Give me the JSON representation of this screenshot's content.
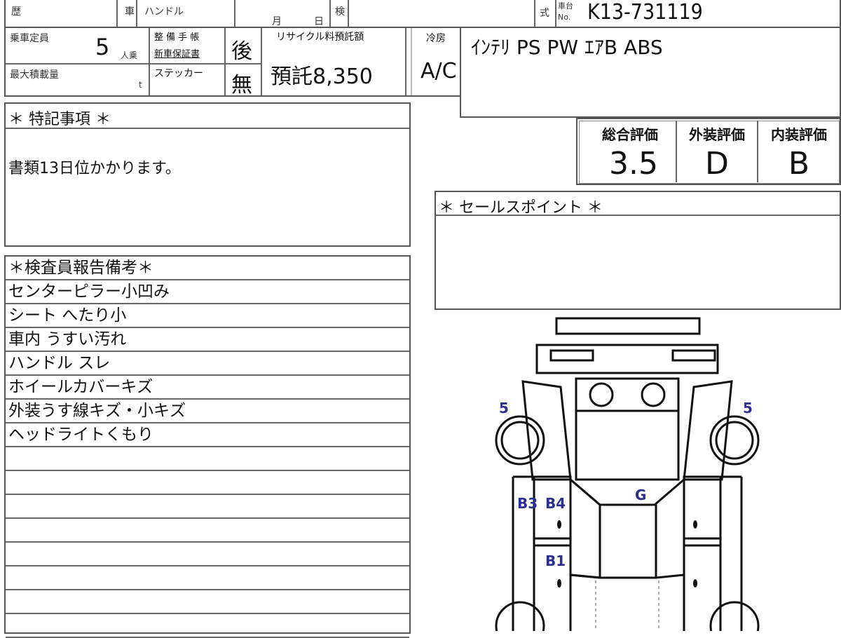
{
  "header": {
    "history_label": "歴",
    "car_label": "車",
    "handle_label": "ハンドル",
    "month_label": "月",
    "day_label": "日",
    "inspection_label": "検",
    "model_label": "式",
    "chassis_label_top": "車台",
    "chassis_label_bottom": "No.",
    "chassis_number": "K13-731119"
  },
  "specs": {
    "capacity_label": "乗車定員",
    "capacity_value": "5",
    "capacity_unit": "人乗",
    "maintenance_label_1": "整 備 手 帳",
    "maintenance_label_2": "新車保証書",
    "maintenance_value": "後",
    "max_load_label": "最大積載量",
    "max_load_unit": "t",
    "sticker_label": "ステッカー",
    "sticker_value": "無",
    "recycle_label": "リサイクル料預託額",
    "recycle_value": "預託8,350",
    "ac_label": "冷房",
    "ac_value": "A/C",
    "equipment": "ｲﾝﾃﾘ PS PW ｴｱB ABS"
  },
  "special_notes": {
    "title": "＊ 特記事項 ＊",
    "text": "書類13日位かかります。"
  },
  "scores": {
    "overall_label": "総合評価",
    "overall_value": "3.5",
    "exterior_label": "外装評価",
    "exterior_value": "D",
    "interior_label": "内装評価",
    "interior_value": "B"
  },
  "sales_point": {
    "title": "＊ セールスポイント ＊"
  },
  "inspector_report": {
    "title": "＊検査員報告備考＊",
    "items": [
      "センターピラー小凹み",
      "シート へたり小",
      "車内 うすい汚れ",
      "ハンドル スレ",
      "ホイールカバーキズ",
      "外装うす線キズ・小キズ",
      "ヘッドライトくもり",
      "",
      "",
      "",
      "",
      "",
      "",
      "",
      ""
    ]
  },
  "diagram": {
    "marks": {
      "left_front_tire": "5",
      "right_front_tire": "5",
      "b3": "B3",
      "b4": "B4",
      "g": "G",
      "b1": "B1"
    },
    "mark_color": "#2b2f8f"
  }
}
